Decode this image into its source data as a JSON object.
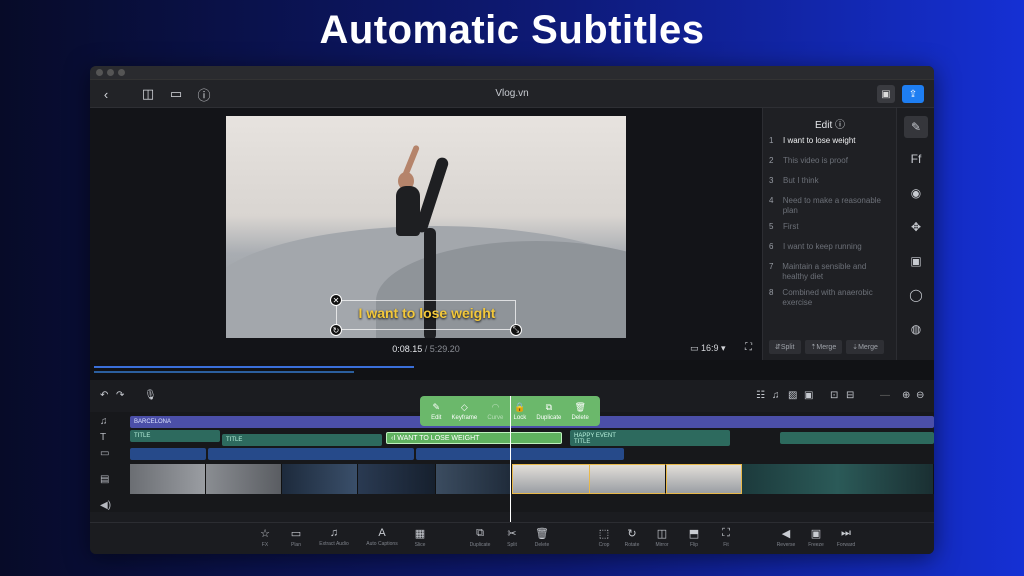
{
  "headline": "Automatic Subtitles",
  "window": {
    "title": "Vlog.vn"
  },
  "toolbar": {
    "back_icon": "chevron-left-icon",
    "layout_icon": "split-view-icon",
    "panel_icon": "layout-bottom-icon",
    "help_icon": "help-circle-icon",
    "save_icon": "save-icon",
    "export_icon": "export-icon"
  },
  "preview": {
    "caption": "I want to lose weight",
    "current_time": "0:08.15",
    "separator": "/",
    "total_time": "5:29.20",
    "aspect_ratio": "16:9 ▾"
  },
  "edit_panel": {
    "title": "Edit",
    "subtitles": [
      {
        "n": "1",
        "text": "I want to lose weight"
      },
      {
        "n": "2",
        "text": "This video is proof"
      },
      {
        "n": "3",
        "text": "But I think"
      },
      {
        "n": "4",
        "text": "Need to make a reasonable plan"
      },
      {
        "n": "5",
        "text": "First"
      },
      {
        "n": "6",
        "text": "I want to keep running"
      },
      {
        "n": "7",
        "text": "Maintain a sensible and healthy diet"
      },
      {
        "n": "8",
        "text": "Combined with anaerobic exercise"
      }
    ],
    "actions": [
      "Split",
      "Merge",
      "Merge"
    ]
  },
  "popup": {
    "items": [
      {
        "icon": "✎",
        "label": "Edit",
        "disabled": false
      },
      {
        "icon": "◇",
        "label": "Keyframe",
        "disabled": false
      },
      {
        "icon": "◠",
        "label": "Curve",
        "disabled": true
      },
      {
        "icon": "🔒",
        "label": "Lock",
        "disabled": false
      },
      {
        "icon": "⧉",
        "label": "Duplicate",
        "disabled": false
      },
      {
        "icon": "🗑",
        "label": "Delete",
        "disabled": false
      }
    ]
  },
  "tracks": {
    "music_label": "BARCELONA",
    "title_1": "TITLE",
    "title_2": "TITLE",
    "selected_subtitle": "I WANT TO LOSE WEIGHT",
    "title_3": "HAPPY EVENT",
    "title_4": "TITLE"
  },
  "bottom_toolbar": [
    {
      "icon": "☆",
      "label": "FX"
    },
    {
      "icon": "▭",
      "label": "Plan"
    },
    {
      "icon": "♫",
      "label": "Extract Audio"
    },
    {
      "icon": "A",
      "label": "Auto Captions"
    },
    {
      "icon": "▦",
      "label": "Slice"
    },
    {
      "icon": "⧉",
      "label": "Duplicate"
    },
    {
      "icon": "✂",
      "label": "Split"
    },
    {
      "icon": "🗑",
      "label": "Delete"
    },
    {
      "icon": "⬚",
      "label": "Crop"
    },
    {
      "icon": "↻",
      "label": "Rotate"
    },
    {
      "icon": "◫",
      "label": "Mirror"
    },
    {
      "icon": "⬒",
      "label": "Flip"
    },
    {
      "icon": "⛶",
      "label": "Fit"
    },
    {
      "icon": "◀",
      "label": "Reverse"
    },
    {
      "icon": "▣",
      "label": "Freeze"
    },
    {
      "icon": "⏭",
      "label": "Forward"
    }
  ]
}
